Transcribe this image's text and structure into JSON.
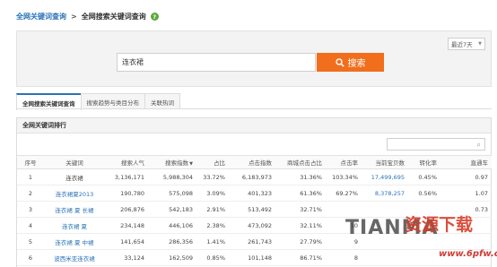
{
  "breadcrumb": {
    "root": "全网关键词查询",
    "separator": ">",
    "current": "全网搜索关键词查询",
    "help": "?"
  },
  "search": {
    "range": "最近7天",
    "query": "连衣裙",
    "button": "搜索"
  },
  "tabs": [
    {
      "label": "全网搜索关键词查询",
      "active": true
    },
    {
      "label": "搜索趋势与类目分布",
      "active": false
    },
    {
      "label": "关联热词",
      "active": false
    }
  ],
  "ranking": {
    "title": "全网关键词排行",
    "columns": [
      "序号",
      "关键词",
      "搜索人气",
      "搜索指数",
      "占比",
      "点击指数",
      "商城点击占比",
      "点击率",
      "当前宝贝数",
      "转化率",
      "直通车"
    ],
    "rows": [
      [
        "1",
        "连衣裙",
        "3,136,171",
        "5,988,304",
        "33.72%",
        "6,183,973",
        "31.36%",
        "103.34%",
        "17,499,695",
        "0.45%",
        "0.97"
      ],
      [
        "2",
        "连衣裙夏2013",
        "190,780",
        "575,098",
        "3.09%",
        "401,323",
        "61.36%",
        "69.27%",
        "8,378,257",
        "0.56%",
        "1.07"
      ],
      [
        "3",
        "连衣裙 夏 长裙",
        "206,876",
        "542,183",
        "2.91%",
        "513,492",
        "32.71%",
        "",
        "",
        "",
        "0.73"
      ],
      [
        "4",
        "连衣裙 夏",
        "234,148",
        "446,106",
        "2.38%",
        "473,092",
        "32.11%",
        "10",
        "",
        "",
        ""
      ],
      [
        "5",
        "连衣裙 夏 中裙",
        "141,654",
        "286,356",
        "1.41%",
        "261,743",
        "27.79%",
        "9",
        "",
        "",
        ""
      ],
      [
        "6",
        "波西米亚连衣裙",
        "33,124",
        "162,509",
        "0.85%",
        "101,148",
        "86.71%",
        "8",
        "",
        "",
        ""
      ]
    ]
  },
  "watermark": {
    "latin": "TIANMA",
    "chinese": "资源下载",
    "url": "www.6pfw.com"
  }
}
